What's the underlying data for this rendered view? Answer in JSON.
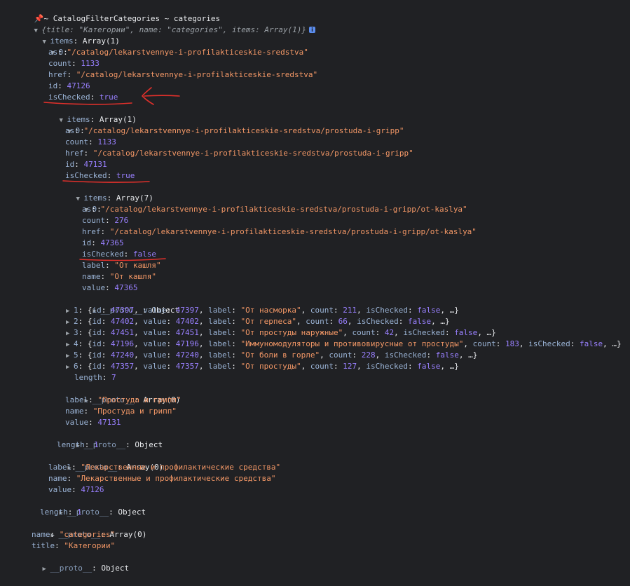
{
  "header": {
    "pin_glyph": "📌",
    "title": "~ CatalogFilterCategories ~ categories",
    "summary": "{title: \"Категории\", name: \"categories\", items: Array(1)}",
    "info_glyph": "i"
  },
  "colors": {
    "background": "#202124",
    "key": "#9ab3d5",
    "string": "#f29766",
    "number": "#9980ff",
    "annotation": "#e0302b"
  },
  "tree": {
    "items_label": "items",
    "items_type": "Array(1)",
    "item0": {
      "index": "0",
      "as": "\"/catalog/lekarstvennye-i-profilakticeskie-sredstva\"",
      "count": "1133",
      "href": "\"/catalog/lekarstvennye-i-profilakticeskie-sredstva\"",
      "id": "47126",
      "isChecked": "true",
      "items_type": "Array(1)",
      "child0": {
        "index": "0",
        "as": "\"/catalog/lekarstvennye-i-profilakticeskie-sredstva/prostuda-i-gripp\"",
        "count": "1133",
        "href": "\"/catalog/lekarstvennye-i-profilakticeskie-sredstva/prostuda-i-gripp\"",
        "id": "47131",
        "isChecked": "true",
        "items_type": "Array(7)",
        "leaf0": {
          "index": "0",
          "as": "\"/catalog/lekarstvennye-i-profilakticeskie-sredstva/prostuda-i-gripp/ot-kaslya\"",
          "count": "276",
          "href": "\"/catalog/lekarstvennye-i-profilakticeskie-sredstva/prostuda-i-gripp/ot-kaslya\"",
          "id": "47365",
          "isChecked": "false",
          "label": "\"От кашля\"",
          "name": "\"От кашля\"",
          "value": "47365",
          "proto": "Object"
        },
        "collapsed": [
          {
            "index": "1",
            "id": "47397",
            "value": "47397",
            "label": "\"От насморка\"",
            "count": "211",
            "isChecked": "false"
          },
          {
            "index": "2",
            "id": "47402",
            "value": "47402",
            "label": "\"От герпеса\"",
            "count": "66",
            "isChecked": "false"
          },
          {
            "index": "3",
            "id": "47451",
            "value": "47451",
            "label": "\"От простуды наружные\"",
            "count": "42",
            "isChecked": "false"
          },
          {
            "index": "4",
            "id": "47196",
            "value": "47196",
            "label": "\"Иммуномодуляторы и противовирусные от простуды\"",
            "count": "183",
            "isChecked": "false"
          },
          {
            "index": "5",
            "id": "47240",
            "value": "47240",
            "label": "\"От боли в горле\"",
            "count": "228",
            "isChecked": "false"
          },
          {
            "index": "6",
            "id": "47357",
            "value": "47357",
            "label": "\"От простуды\"",
            "count": "127",
            "isChecked": "false"
          }
        ],
        "inner_length": "7",
        "inner_proto": "Array(0)",
        "label": "\"Простуда и грипп\"",
        "name": "\"Простуда и грипп\"",
        "value": "47131",
        "proto": "Object"
      },
      "mid_length": "1",
      "mid_proto": "Array(0)",
      "label": "\"Лекарственные и профилактические средства\"",
      "name": "\"Лекарственные и профилактические средства\"",
      "value": "47126",
      "proto": "Object"
    },
    "outer_length": "1",
    "outer_proto": "Array(0)",
    "name": "\"categories\"",
    "title": "\"Категории\"",
    "root_proto": "Object"
  },
  "keys": {
    "as": "as",
    "count": "count",
    "href": "href",
    "id": "id",
    "isChecked": "isChecked",
    "items": "items",
    "label": "label",
    "name": "name",
    "value": "value",
    "length": "length",
    "title": "title",
    "proto": "__proto__"
  }
}
